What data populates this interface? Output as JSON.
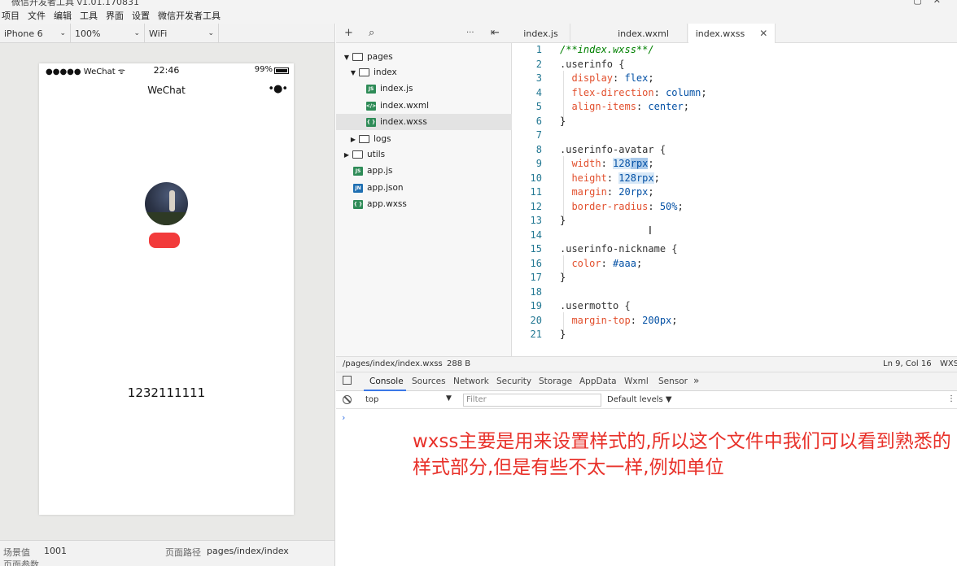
{
  "window": {
    "title": "微信开发者工具 v1.01.170831",
    "controls": [
      "▢",
      "✕"
    ]
  },
  "menu": [
    "项目",
    "文件",
    "编辑",
    "工具",
    "界面",
    "设置",
    "微信开发者工具"
  ],
  "sim_toolbar": {
    "device": "iPhone 6",
    "zoom": "100%",
    "network": "WiFi",
    "chev": "⌄"
  },
  "phone": {
    "carrier": "●●●●● WeChat ᯤ",
    "time": "22:46",
    "battery": "99%",
    "nav_title": "WeChat",
    "nav_more": "•●•",
    "motto": "1232111111"
  },
  "sim_footer": {
    "scene_label": "场景值",
    "scene_value": "1001",
    "path_label": "页面路径",
    "path_value": "pages/index/index",
    "params_label": "页面参数"
  },
  "files_toolbar": {
    "add": "+",
    "search": "⌕",
    "more": "···",
    "collapse": "⇤"
  },
  "tree": [
    {
      "label": "pages",
      "type": "folder",
      "twisty": "▼"
    },
    {
      "label": "index",
      "type": "folder",
      "twisty": "▼"
    },
    {
      "label": "index.js",
      "type": "js",
      "badge": "JS"
    },
    {
      "label": "index.wxml",
      "type": "wx",
      "badge": "</>"
    },
    {
      "label": "index.wxss",
      "type": "wx",
      "badge": "{ }"
    },
    {
      "label": "logs",
      "type": "folder",
      "twisty": "▶"
    },
    {
      "label": "utils",
      "type": "folder",
      "twisty": "▶"
    },
    {
      "label": "app.js",
      "type": "js",
      "badge": "JS"
    },
    {
      "label": "app.json",
      "type": "json",
      "badge": "JN"
    },
    {
      "label": "app.wxss",
      "type": "wx",
      "badge": "{ }"
    }
  ],
  "tabs": [
    {
      "label": "index.js"
    },
    {
      "label": "index.wxml"
    },
    {
      "label": "index.wxss",
      "close": "✕"
    }
  ],
  "code_lines": [
    "1",
    "2",
    "3",
    "4",
    "5",
    "6",
    "7",
    "8",
    "9",
    "10",
    "11",
    "12",
    "13",
    "14",
    "15",
    "16",
    "17",
    "18",
    "19",
    "20",
    "21"
  ],
  "code": {
    "l1": "/**index.wxss**/",
    "l2": ".userinfo {",
    "l3p": "display",
    "l3v": "flex",
    "l4p": "flex-direction",
    "l4v": "column",
    "l5p": "align-items",
    "l5v": "center",
    "l6": "}",
    "l8": ".userinfo-avatar {",
    "l9p": "width",
    "l9a": "128",
    "l9b": "rpx",
    "l10p": "height",
    "l10a": "128",
    "l10b": "rpx",
    "l11p": "margin",
    "l11v": "20rpx",
    "l12p": "border-radius",
    "l12v": "50%",
    "l13": "}",
    "l15": ".userinfo-nickname {",
    "l16p": "color",
    "l16v": "#aaa",
    "l17": "}",
    "l19": ".usermotto {",
    "l20p": "margin-top",
    "l20v": "200px",
    "l21": "}"
  },
  "statusbar": {
    "path": "/pages/index/index.wxss",
    "size": "288 B",
    "position": "Ln 9, Col 16",
    "lang": "WXSS"
  },
  "devtools_tabs": [
    "Console",
    "Sources",
    "Network",
    "Security",
    "Storage",
    "AppData",
    "Wxml",
    "Sensor",
    "»"
  ],
  "console_filter": {
    "context": "top",
    "context_arrow": "▼",
    "placeholder": "Filter",
    "levels": "Default levels ▼",
    "more": "⋮"
  },
  "console": {
    "prompt": "›"
  },
  "annotation": "wxss主要是用来设置样式的,所以这个文件中我们可以看到熟悉的样式部分,但是有些不太一样,例如单位"
}
